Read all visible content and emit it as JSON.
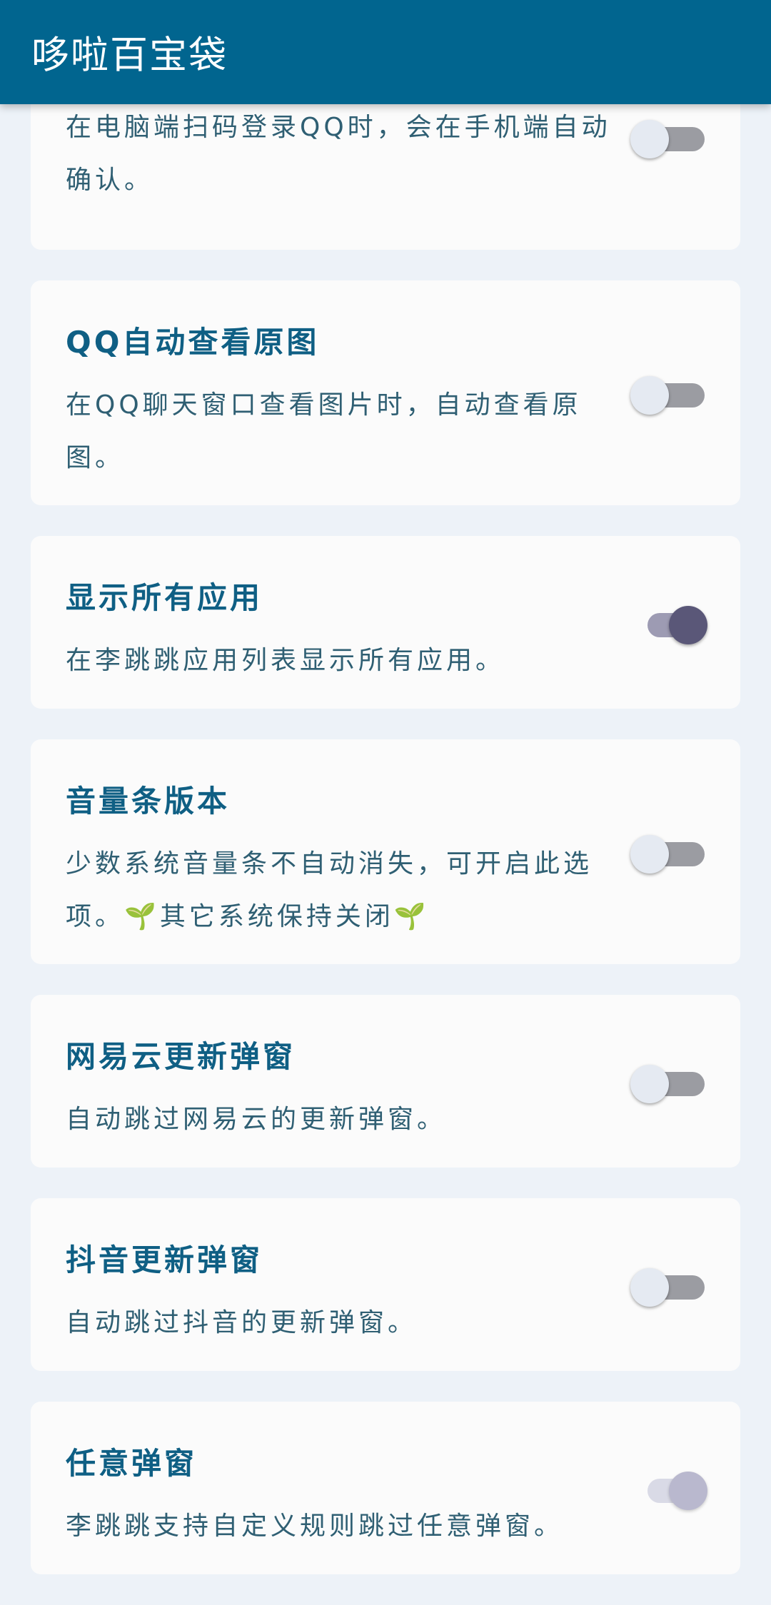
{
  "app": {
    "title": "哆啦百宝袋"
  },
  "items": [
    {
      "title": "",
      "desc": "在电脑端扫码登录QQ时，会在手机端自动确认。",
      "enabled": false
    },
    {
      "title": "QQ自动查看原图",
      "desc": "在QQ聊天窗口查看图片时，自动查看原图。",
      "enabled": false
    },
    {
      "title": "显示所有应用",
      "desc": "在李跳跳应用列表显示所有应用。",
      "enabled": true
    },
    {
      "title": "音量条版本",
      "desc": "少数系统音量条不自动消失，可开启此选项。🌱其它系统保持关闭🌱",
      "enabled": false
    },
    {
      "title": "网易云更新弹窗",
      "desc": "自动跳过网易云的更新弹窗。",
      "enabled": false
    },
    {
      "title": "抖音更新弹窗",
      "desc": "自动跳过抖音的更新弹窗。",
      "enabled": false
    },
    {
      "title": "任意弹窗",
      "desc": "李跳跳支持自定义规则跳过任意弹窗。",
      "enabled": true,
      "disabled": true
    }
  ]
}
